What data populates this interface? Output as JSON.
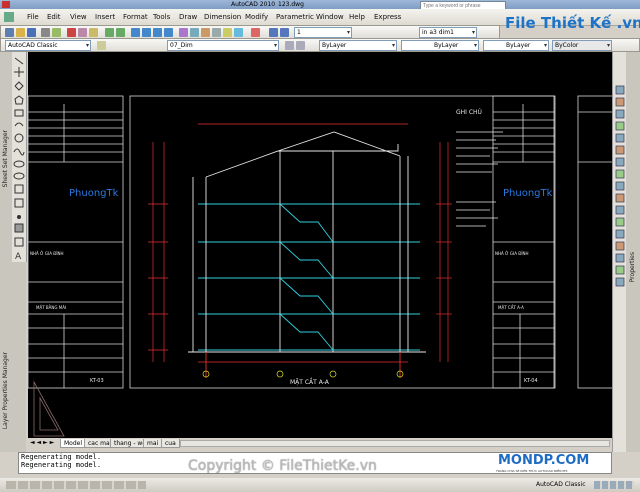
{
  "titlebar": {
    "app": "AutoCAD 2010",
    "file": "123.dwg",
    "search_placeholder": "Type a keyword or phrase"
  },
  "menu": [
    "File",
    "Edit",
    "View",
    "Insert",
    "Format",
    "Tools",
    "Draw",
    "Dimension",
    "Modify",
    "Parametric",
    "Window",
    "Help",
    "Express"
  ],
  "toolbar": {
    "workspace": "AutoCAD Classic",
    "layer": "07_Dim",
    "color": "ByLayer",
    "linetype": "ByLayer",
    "lineweight": "ByLayer",
    "plotstyle": "ByColor",
    "dimstyle": "in a3 dim1",
    "scale": "1"
  },
  "drawing": {
    "section_title": "MẶT CẮT A-A",
    "notes_title": "GHI CHÚ",
    "left_sheet": {
      "brand": "PhuongTk",
      "project": "NHÀ Ở GIA ĐÌNH",
      "sheet_name": "MẶT BẰNG MÁI",
      "sheet_no": "KT-03"
    },
    "right_sheet": {
      "brand": "PhuongTk",
      "project": "NHÀ Ở GIA ĐÌNH",
      "sheet_name": "MẶT CẮT A-A",
      "sheet_no": "KT-04"
    }
  },
  "tabs": [
    "Model",
    "cac mat",
    "thang - wc",
    "mai",
    "cua"
  ],
  "command_lines": [
    "Regenerating model.",
    "Regenerating model."
  ],
  "palettes": {
    "left_top": "Sheet Set Manager",
    "left_bottom": "Layer Properties Manager",
    "right": "Properties"
  },
  "watermarks": {
    "copyright": "Copyright © FileThietKe.vn",
    "logo": "File Thiết Kế .vn",
    "logo2": "MONDP.COM",
    "logo2_sub": "TRANG CHIA SẺ KIẾN THỨC AUTOCAD MIỄN PHÍ"
  },
  "status": {
    "workspace": "AutoCAD Classic"
  },
  "colors": {
    "drawing_bg": "#000000",
    "frame": "#e8e8e8",
    "cyan": "#2fd0e0",
    "red": "#e83030",
    "blue_brand": "#2a78e0",
    "yellow": "#e0e020"
  }
}
